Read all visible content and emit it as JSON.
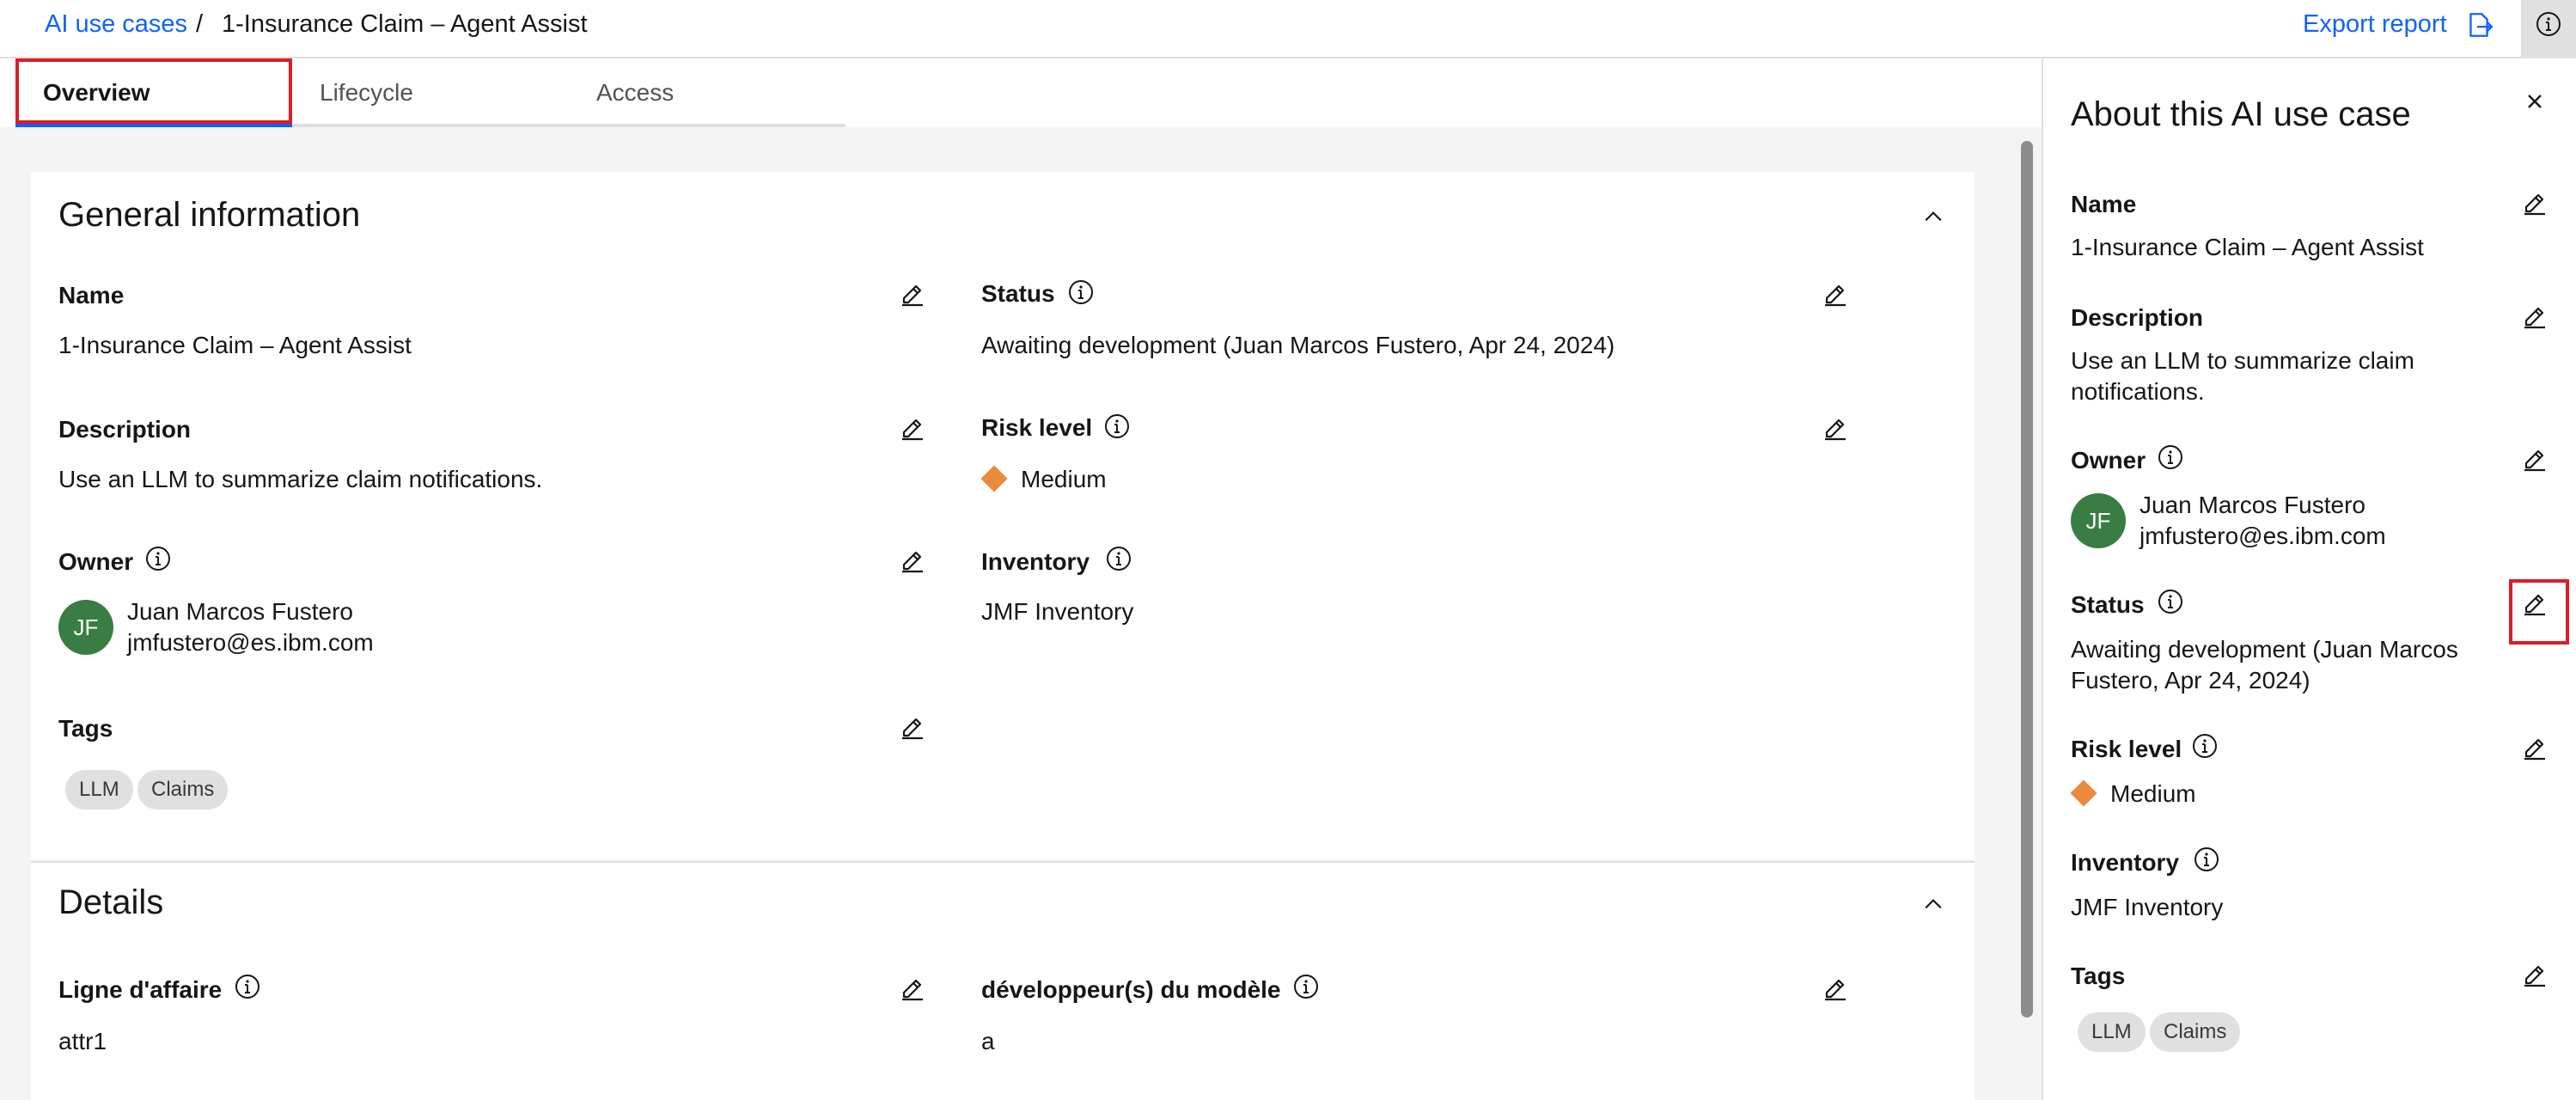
{
  "breadcrumb": {
    "parent": "AI use cases",
    "separator": "/",
    "current": "1-Insurance Claim – Agent Assist"
  },
  "header": {
    "export_label": "Export report",
    "export_icon": "export-icon",
    "info_icon": "information-icon"
  },
  "tabs": [
    {
      "label": "Overview",
      "active": true
    },
    {
      "label": "Lifecycle",
      "active": false
    },
    {
      "label": "Access",
      "active": false
    }
  ],
  "general": {
    "title": "General information",
    "name_label": "Name",
    "name_value": "1-Insurance Claim – Agent Assist",
    "status_label": "Status",
    "status_value": "Awaiting development (Juan Marcos Fustero, Apr 24, 2024)",
    "description_label": "Description",
    "description_value": "Use an LLM to summarize claim notifications.",
    "risk_label": "Risk level",
    "risk_value": "Medium",
    "risk_color": "#eb8a3c",
    "owner_label": "Owner",
    "owner_initials": "JF",
    "owner_name": "Juan Marcos Fustero",
    "owner_email": "jmfustero@es.ibm.com",
    "inventory_label": "Inventory",
    "inventory_value": "JMF Inventory",
    "tags_label": "Tags",
    "tags": [
      "LLM",
      "Claims"
    ]
  },
  "details": {
    "title": "Details",
    "line_label": "Ligne d'affaire",
    "line_value": "attr1",
    "dev_label": "développeur(s) du modèle",
    "dev_value": "a"
  },
  "panel": {
    "title": "About this AI use case",
    "name_label": "Name",
    "name_value": "1-Insurance Claim – Agent Assist",
    "description_label": "Description",
    "description_value_line1": "Use an LLM to summarize claim",
    "description_value_line2": "notifications.",
    "owner_label": "Owner",
    "owner_initials": "JF",
    "owner_name": "Juan Marcos Fustero",
    "owner_email": "jmfustero@es.ibm.com",
    "status_label": "Status",
    "status_value_line1": "Awaiting development (Juan Marcos",
    "status_value_line2": "Fustero, Apr 24, 2024)",
    "risk_label": "Risk level",
    "risk_value": "Medium",
    "inventory_label": "Inventory",
    "inventory_value": "JMF Inventory",
    "tags_label": "Tags",
    "tags": [
      "LLM",
      "Claims"
    ]
  },
  "colors": {
    "link": "#0f62fe",
    "highlight": "#da1e28",
    "avatar": "#3a7d44"
  }
}
